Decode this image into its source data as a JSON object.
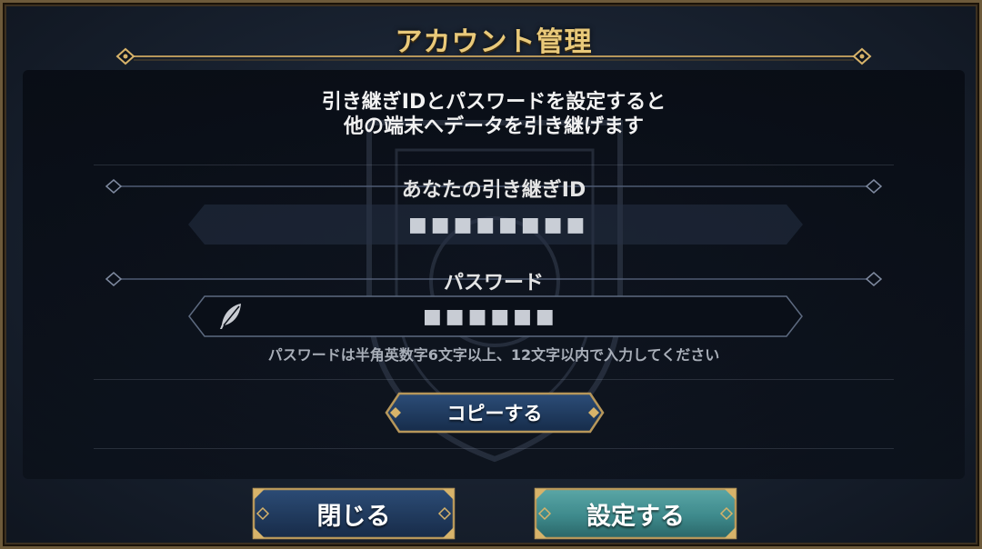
{
  "dialog": {
    "title": "アカウント管理",
    "intro_line1": "引き継ぎIDとパスワードを設定すると",
    "intro_line2": "他の端末へデータを引き継げます"
  },
  "transfer_id": {
    "label": "あなたの引き継ぎID",
    "value": "■■■■■■■■"
  },
  "password": {
    "label": "パスワード",
    "value": "■■■■■■",
    "hint": "パスワードは半角英数字6文字以上、12文字以内で入力してください"
  },
  "buttons": {
    "copy": "コピーする",
    "close": "閉じる",
    "set": "設定する"
  },
  "icons": {
    "password_field": "feather-quill-icon",
    "ornament": "diamond-ornament-icon"
  },
  "colors": {
    "title_gold": "#e9c97a",
    "frame_gold": "#b7975a",
    "panel_bg": "#0c121d",
    "button_navy": "#1e3a60",
    "button_teal": "#3e8a8c"
  }
}
